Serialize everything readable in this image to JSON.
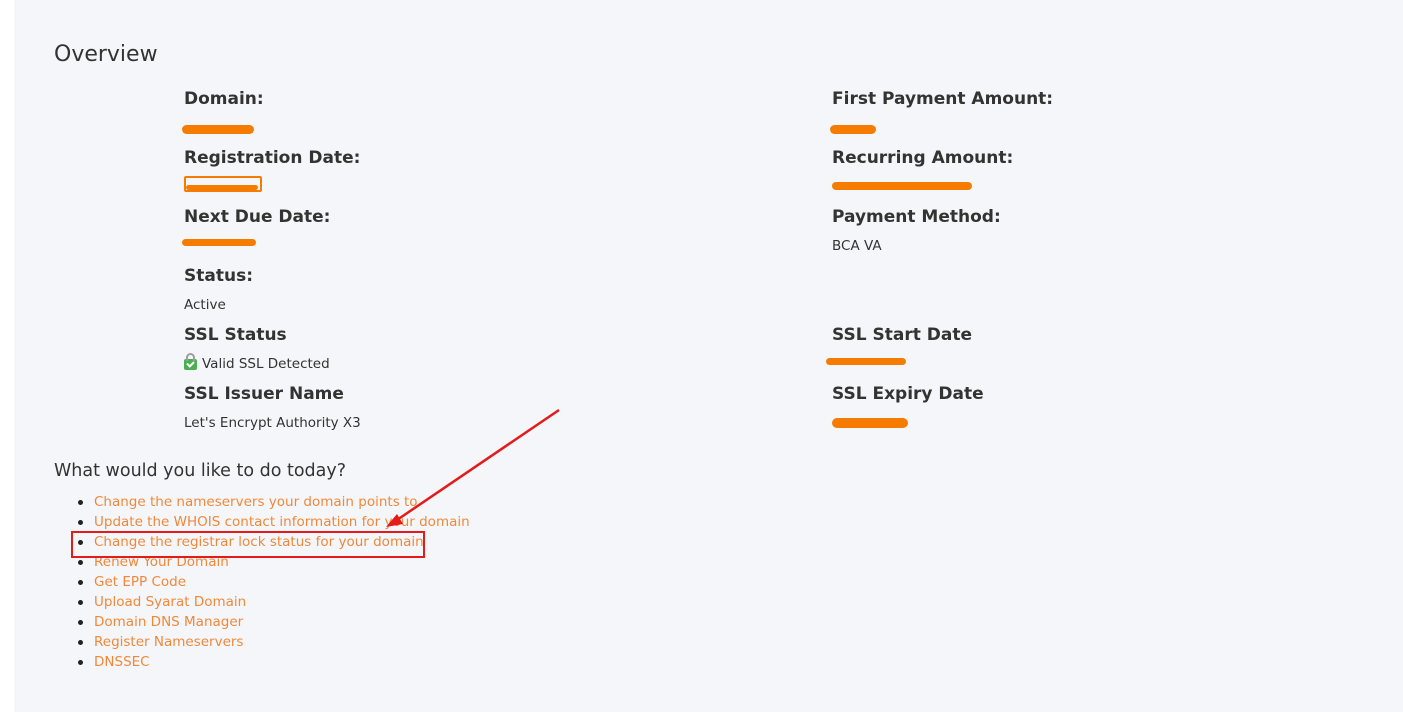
{
  "overview": {
    "title": "Overview",
    "fields_left": [
      {
        "label": "Domain:",
        "value": ""
      },
      {
        "label": "Registration Date:",
        "value": ""
      },
      {
        "label": "Next Due Date:",
        "value": ""
      },
      {
        "label": "Status:",
        "value": "Active"
      },
      {
        "label": "SSL Status",
        "value": "Valid SSL Detected"
      },
      {
        "label": "SSL Issuer Name",
        "value": "Let's Encrypt Authority X3"
      }
    ],
    "fields_right": [
      {
        "label": "First Payment Amount:",
        "value": ""
      },
      {
        "label": "Recurring Amount:",
        "value": ""
      },
      {
        "label": "Payment Method:",
        "value": "BCA VA"
      },
      {
        "label": "SSL Start Date",
        "value": ""
      },
      {
        "label": "SSL Expiry Date",
        "value": ""
      }
    ]
  },
  "actions": {
    "heading": "What would you like to do today?",
    "items": [
      {
        "label": "Change the nameservers your domain points to"
      },
      {
        "label": "Update the WHOIS contact information for your domain"
      },
      {
        "label": "Change the registrar lock status for your domain"
      },
      {
        "label": "Renew Your Domain"
      },
      {
        "label": "Get EPP Code"
      },
      {
        "label": "Upload Syarat Domain"
      },
      {
        "label": "Domain DNS Manager"
      },
      {
        "label": "Register Nameservers"
      },
      {
        "label": "DNSSEC"
      }
    ]
  },
  "colors": {
    "link": "#f0883a",
    "redaction": "#f57c00",
    "annotation": "#e31b1b",
    "ssl_valid": "#4caf50"
  },
  "icons": {
    "ssl_status": "ssl-lock-icon"
  }
}
